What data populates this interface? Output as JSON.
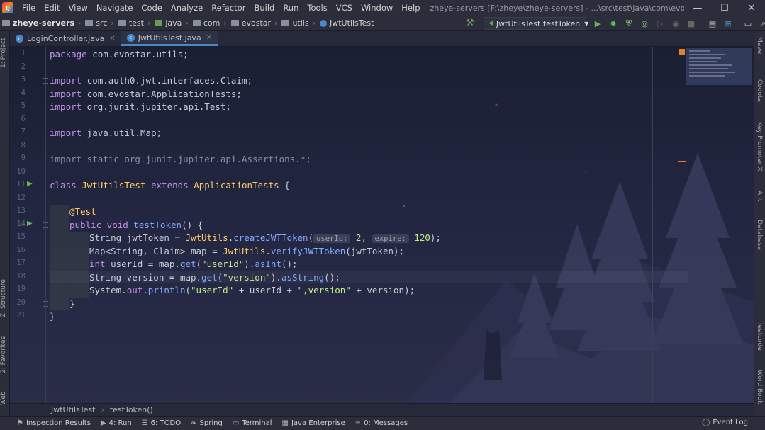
{
  "window": {
    "app_icon": "IJ",
    "menu": [
      "File",
      "Edit",
      "View",
      "Navigate",
      "Code",
      "Analyze",
      "Refactor",
      "Build",
      "Run",
      "Tools",
      "VCS",
      "Window",
      "Help"
    ],
    "title": "zheye-servers [F:\\zheye\\zheye-servers] - ...\\src\\test\\java\\com\\evostar\\utils\\JwtUtilsTest.java",
    "controls": {
      "minimize": "—",
      "maximize": "☐",
      "close": "✕"
    }
  },
  "navbar": {
    "crumbs": [
      "zheye-servers",
      "src",
      "test",
      "java",
      "com",
      "evostar",
      "utils",
      "JwtUtilsTest"
    ],
    "run_config": "JwtUtilsTest.testToken"
  },
  "left_strip": {
    "project": "1: Project",
    "structure": "Z: Structure",
    "favorites": "2: Favorites",
    "web": "Web"
  },
  "right_strip": {
    "maven": "Maven",
    "codota": "Codota",
    "key_promoter": "Key Promoter X",
    "ant": "Ant",
    "database": "Database",
    "leetcode": "leetcode",
    "word_book": "Word Book"
  },
  "tabs": [
    {
      "label": "LoginController.java",
      "active": false
    },
    {
      "label": "JwtUtilsTest.java",
      "active": true
    }
  ],
  "code": {
    "line_numbers": [
      "1",
      "2",
      "3",
      "4",
      "5",
      "6",
      "7",
      "8",
      "9",
      "10",
      "11",
      "12",
      "13",
      "14",
      "15",
      "16",
      "17",
      "18",
      "19",
      "20",
      "21"
    ],
    "l1_kw": "package",
    "l1_rest": " com.evostar.utils;",
    "l3_kw": "import",
    "l3_rest": " com.auth0.jwt.interfaces.Claim;",
    "l4_kw": "import",
    "l4_rest": " com.evostar.ApplicationTests;",
    "l5_kw": "import",
    "l5_rest": " org.junit.jupiter.api.Test;",
    "l7_kw": "import",
    "l7_rest": " java.util.Map;",
    "l9": "import static org.junit.jupiter.api.Assertions.*;",
    "l11_kw1": "class",
    "l11_cls": "JwtUtilsTest",
    "l11_kw2": "extends",
    "l11_base": "ApplicationTests",
    "l11_brace": " {",
    "l13": "@Test",
    "l14_kw": "public void",
    "l14_fn": "testToken",
    "l14_rest": "() {",
    "l15_a": "String jwtToken = ",
    "l15_cls": "JwtUtils",
    "l15_dot": ".",
    "l15_fn": "createJWTToken",
    "l15_p": "(",
    "l15_h1": "userId:",
    "l15_v1": "2",
    "l15_c": ", ",
    "l15_h2": "expire:",
    "l15_v2": "120",
    "l15_end": ");",
    "l16_a": "Map<String, Claim> map = ",
    "l16_cls": "JwtUtils",
    "l16_dot": ".",
    "l16_fn": "verifyJWTToken",
    "l16_end": "(jwtToken);",
    "l17_kw": "int",
    "l17_a": " userId = map.",
    "l17_fn": "get",
    "l17_p": "(",
    "l17_s": "\"userId\"",
    "l17_b": ").",
    "l17_fn2": "asInt",
    "l17_end": "();",
    "l18_a": "String version = map.",
    "l18_fn": "get",
    "l18_p": "(",
    "l18_s": "\"version\"",
    "l18_b": ").",
    "l18_fn2": "asString",
    "l18_end": "();",
    "l19_a": "System.",
    "l19_out": "out",
    "l19_dot": ".",
    "l19_fn": "println",
    "l19_p": "(",
    "l19_s1": "\"userId\"",
    "l19_b": " + userId + ",
    "l19_s2": "\",version\"",
    "l19_end": " + version);",
    "l20": "}",
    "l21": "}"
  },
  "editor_footer": {
    "class_name": "JwtUtilsTest",
    "method_name": "testToken()"
  },
  "statusbar": {
    "items": [
      "Inspection Results",
      "4: Run",
      "6: TODO",
      "Spring",
      "Terminal",
      "Java Enterprise",
      "0: Messages"
    ],
    "event_log": "Event Log"
  }
}
